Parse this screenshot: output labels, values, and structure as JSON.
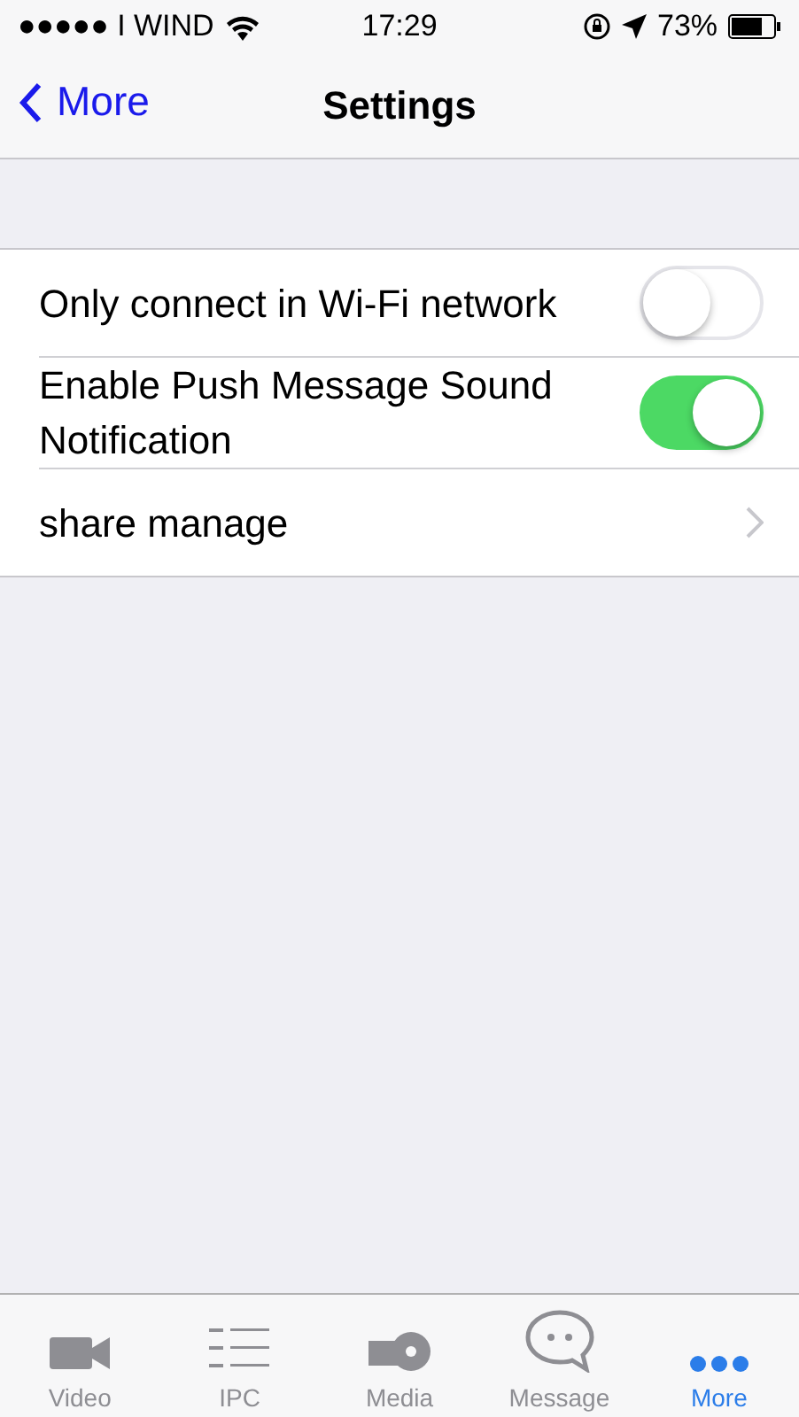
{
  "status_bar": {
    "carrier": "●●●●● I WIND",
    "time": "17:29",
    "battery": "73%"
  },
  "nav_bar": {
    "back": "More",
    "title": "Settings"
  },
  "settings": [
    {
      "kind": "toggle",
      "label": "Only connect in Wi-Fi network",
      "on": false
    },
    {
      "kind": "toggle",
      "label": "Enable Push Message Sound Notification",
      "on": true
    },
    {
      "kind": "link",
      "label": "share manage"
    }
  ],
  "tabs": [
    {
      "kind": "video",
      "label": "Video",
      "selected": false
    },
    {
      "kind": "list",
      "label": "IPC",
      "selected": false
    },
    {
      "kind": "media",
      "label": "Media",
      "selected": false
    },
    {
      "kind": "message",
      "label": "Message",
      "selected": false
    },
    {
      "kind": "more",
      "label": "More",
      "selected": true
    }
  ]
}
